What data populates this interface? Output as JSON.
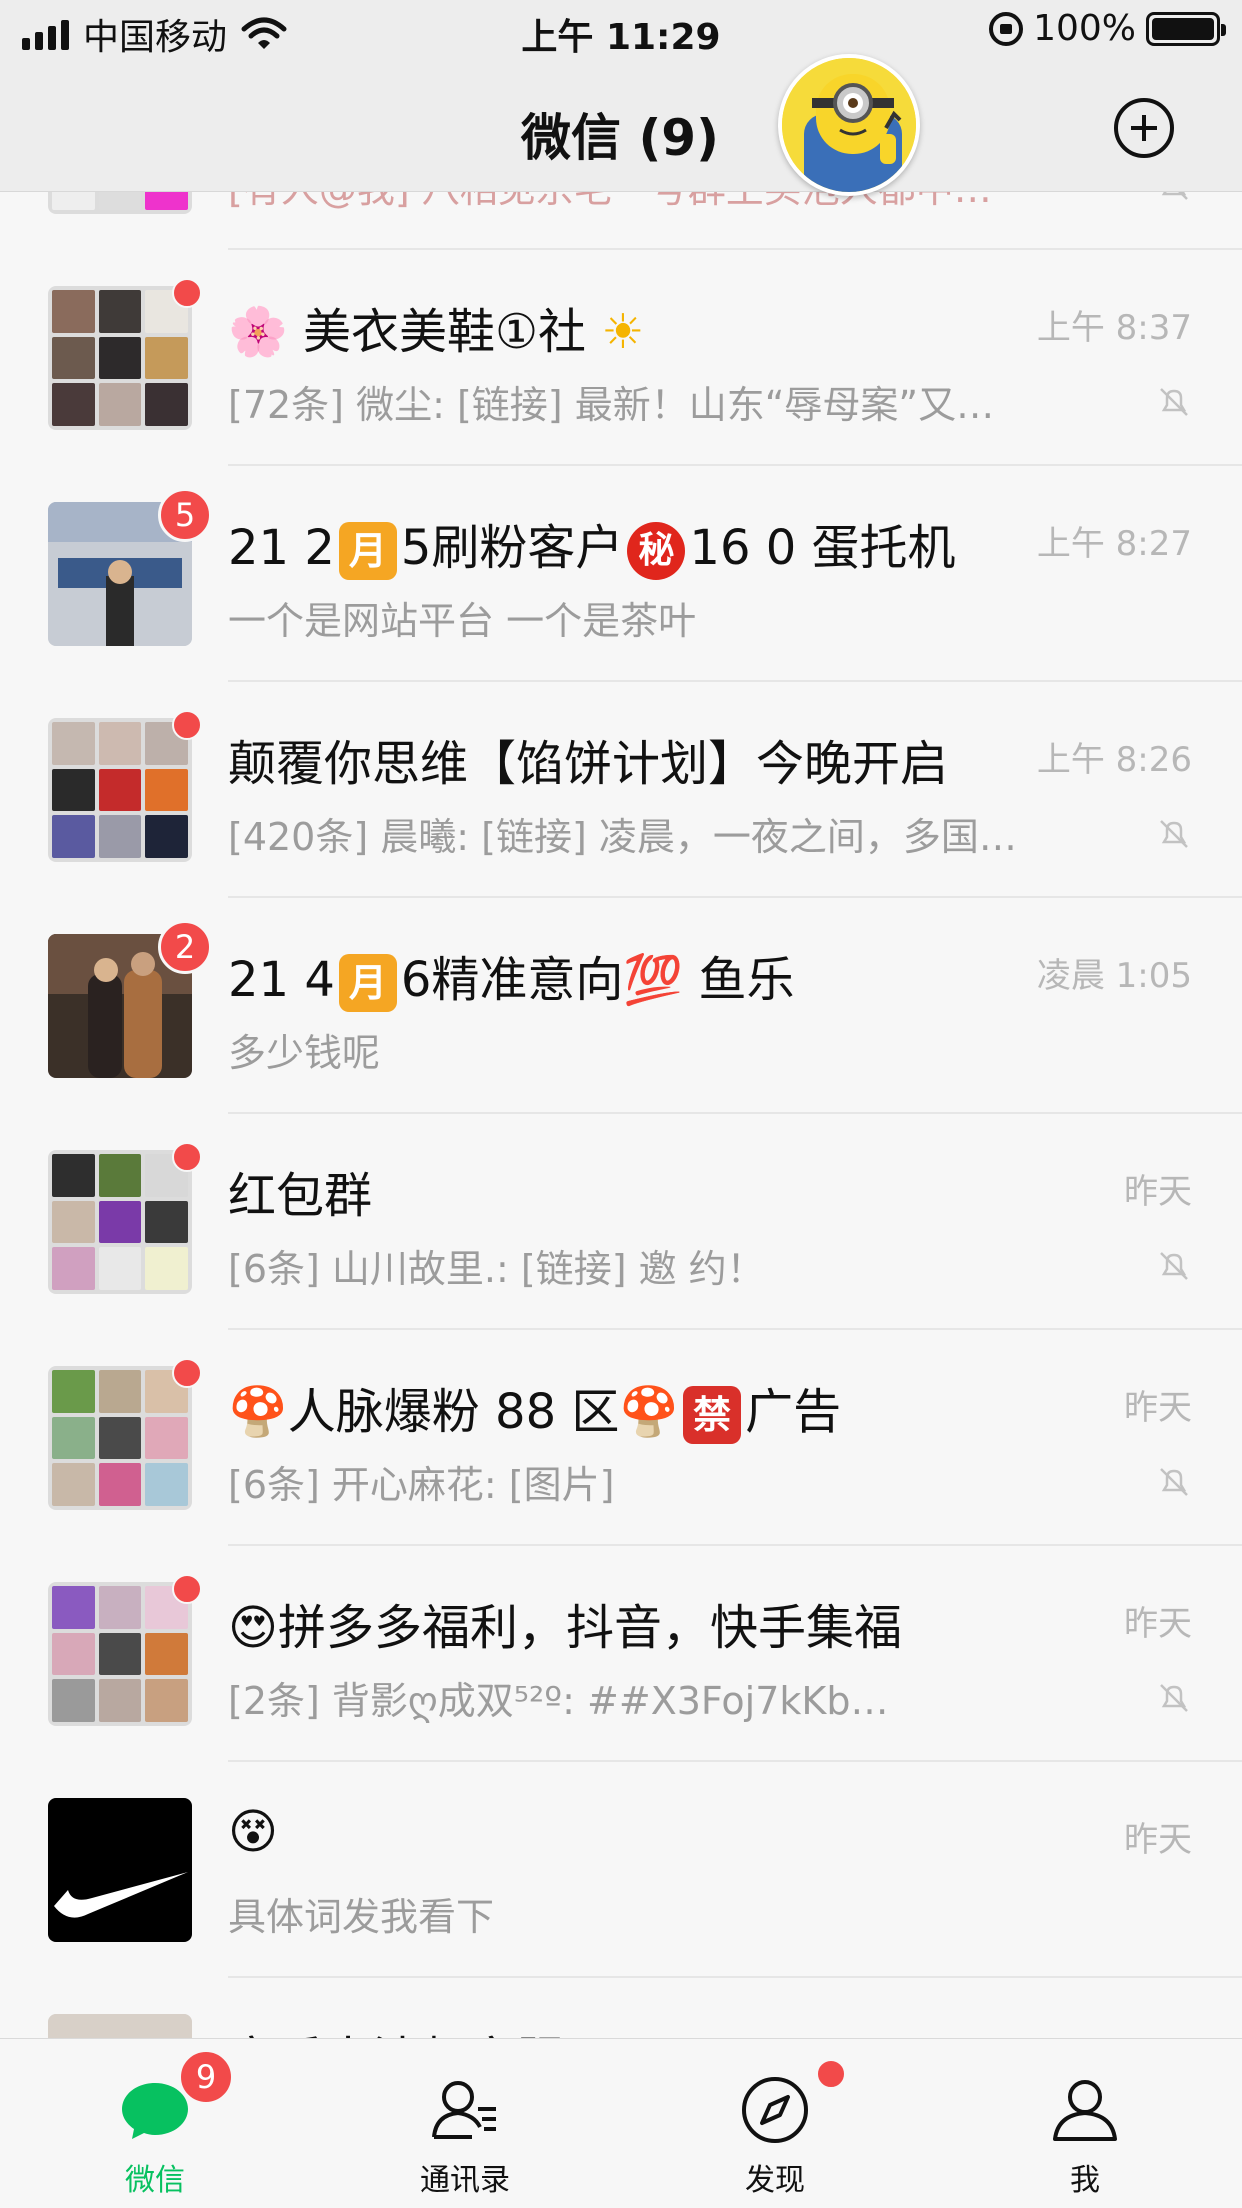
{
  "status_bar": {
    "carrier": "中国移动",
    "time": "上午 11:29",
    "battery": "100%"
  },
  "nav": {
    "title": "微信 (9)"
  },
  "chats": [
    {
      "name": "[有人@我] 八相见宗毛一号群主买泡人都中…",
      "time": "",
      "message": "",
      "unread": ""
    },
    {
      "name_pre": "🌸 美衣美鞋①社",
      "name_post": "",
      "time": "上午 8:37",
      "message": "[72条] 微尘: [链接] 最新！山东“辱母案”又…",
      "muted": true
    },
    {
      "name_pre": "21 2",
      "box1": "月",
      "name_mid": "5刷粉客户",
      "box2": "秘",
      "name_post": "16 0  蛋托机",
      "time": "上午 8:27",
      "message": "一个是网站平台  一个是茶叶",
      "badge": "5"
    },
    {
      "name": "颠覆你思维【馅饼计划】今晚开启",
      "time": "上午 8:26",
      "message": "[420条] 晨曦: [链接] 凌晨，一夜之间，多国…",
      "muted": true
    },
    {
      "name_pre": "21 4",
      "box1": "月",
      "name_mid": "6精准意向",
      "emoji_100": "💯",
      "name_post": "鱼乐",
      "time": "凌晨 1:05",
      "message": "多少钱呢",
      "badge": "2"
    },
    {
      "name": "红包群",
      "time": "昨天",
      "message": "[6条] 山川故里.: [链接] 邀 约！",
      "muted": true
    },
    {
      "name_pre": "🍄人脉爆粉 88 区🍄",
      "box3": "禁",
      "name_post": "广告",
      "time": "昨天",
      "message": "[6条] 开心麻花: [图片]",
      "muted": true
    },
    {
      "name": "😍拼多多福利，抖音，快手集福",
      "time": "昨天",
      "message": "[2条] 背影ღ成双⁵²º: ##X3Foj7kKb…",
      "muted": true
    },
    {
      "name": "😵",
      "time": "昨天",
      "message": "具体词发我看下"
    },
    {
      "name": "音乐大法师宾服",
      "time": "昨天",
      "message": ""
    }
  ],
  "tabs": [
    {
      "label": "微信",
      "badge": "9",
      "active": true
    },
    {
      "label": "通讯录"
    },
    {
      "label": "发现"
    },
    {
      "label": "我"
    }
  ],
  "colors": {
    "accent": "#07c160",
    "badge": "#f24a4a",
    "muted_text": "#9c9c9c"
  }
}
